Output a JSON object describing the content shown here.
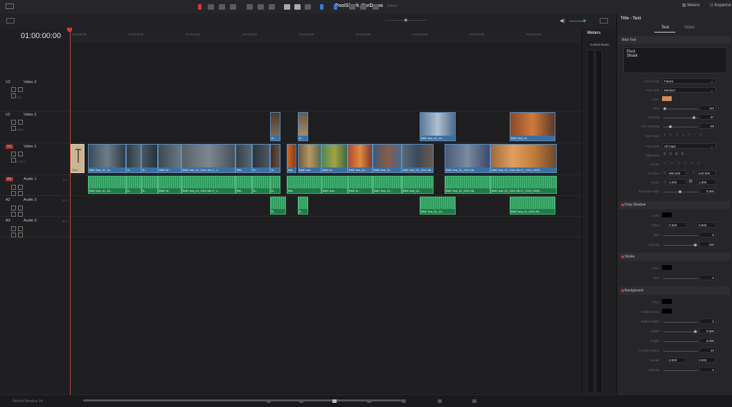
{
  "app": {
    "project_title": "PoolShark_ForDemo",
    "project_status": "Edited",
    "meters_button": "Meters",
    "inspector_button": "Inspector",
    "brand": "DaVinci Resolve 14"
  },
  "timeline": {
    "timecode": "01:00:00:00",
    "ruler_ticks": [
      "01:00:00:00",
      "01:00:10:00",
      "01:00:20:00",
      "01:00:30:00",
      "01:00:40:00",
      "01:00:50:00",
      "01:01:00:00",
      "01:01:10:00",
      "01:01:20:00"
    ],
    "tracks": [
      {
        "id": "V3",
        "name": "Video 3",
        "count": "0 Clip"
      },
      {
        "id": "V2",
        "name": "Video 2",
        "count": "6 Clips"
      },
      {
        "id": "V1",
        "name": "Video 1",
        "count": "18 Clips"
      },
      {
        "id": "A1",
        "name": "Audio 1",
        "vol": "2.0"
      },
      {
        "id": "A2",
        "name": "Audio 2",
        "vol": "2.0"
      },
      {
        "id": "A3",
        "name": "Audio 3",
        "vol": "2.0"
      }
    ],
    "v1_clip_labels": [
      "BMC test_01_20...",
      "B...",
      "B...",
      "BMC te...",
      "BMC test_01_2012-08-17_1...",
      "BM...",
      "B...",
      "B...",
      "BM...",
      "BMC test...",
      "BMC te...",
      "BMC test_01...",
      "BMC test_01...",
      "BMC test_01_2012-08...",
      "BMC test_01_2012-08-17_1754_C005..."
    ],
    "v2_clip_labels": [
      "B...",
      "BMC test_01_20...",
      "BMC test_01..."
    ],
    "text_clip_label": "Text...",
    "a1_clip_labels": [
      "BMC test_01_20...",
      "B...",
      "B...",
      "BMC te...",
      "BMC test_01_2012-08-17_1...",
      "BM...",
      "B...",
      "B...",
      "BM...",
      "BMC test...",
      "BMC te...",
      "BMC test_01...",
      "BMC test_01...",
      "BMC test_01_2012-08...",
      "BMC test_01_2012-08-17_1754_C005..."
    ],
    "a2_clip_labels": [
      "B...",
      "B...",
      "BMC test_01_20...",
      "BMC test_01_2012-08..."
    ]
  },
  "meters": {
    "title": "Meters",
    "control_room": "Control Room"
  },
  "inspector": {
    "title": "Title - Text",
    "tabs": [
      "Text",
      "Video"
    ],
    "rich_text_header": "Rich Text",
    "rich_text_value": [
      "Pool",
      "Shark"
    ],
    "props": {
      "font_family": {
        "label": "Font family",
        "value": "Futura"
      },
      "font_face": {
        "label": "Font face",
        "value": "Medium"
      },
      "color": {
        "label": "Color",
        "value": "#d68a5a"
      },
      "size": {
        "label": "Size",
        "value": "113"
      },
      "tracking": {
        "label": "Tracking",
        "value": "97"
      },
      "line_spacing": {
        "label": "Line Spacing",
        "value": "-58"
      },
      "kern_style": {
        "label": "Kern style"
      },
      "font_case": {
        "label": "Font case",
        "value": "All Caps"
      },
      "alignment": {
        "label": "Alignment"
      },
      "anchor": {
        "label": "Anchor"
      },
      "position": {
        "label": "Position",
        "x": "960.000",
        "y": "540.000"
      },
      "zoom": {
        "label": "Zoom",
        "x": "1.000",
        "y": "1.000"
      },
      "rotation": {
        "label": "Rotation Angle",
        "value": "0.000"
      }
    },
    "drop_shadow": {
      "header": "Drop Shadow",
      "color_label": "Color",
      "offset_label": "Offset",
      "offset_x": "0.000",
      "offset_y": "0.000",
      "blur_label": "Blur",
      "blur": "5",
      "opacity_label": "Opacity",
      "opacity": "100"
    },
    "stroke": {
      "header": "Stroke",
      "color_label": "Color",
      "size_label": "Size",
      "size": "0"
    },
    "background": {
      "header": "Background",
      "color_label": "Color",
      "outline_color_label": "Outline Color",
      "outline_width_label": "Outline Width",
      "outline_width": "0",
      "width_label": "Width",
      "width": "0.900",
      "height_label": "Height",
      "height": "0.000",
      "corner_radius_label": "Corner Radius",
      "corner_radius": "40",
      "center_label": "Center",
      "center_x": "0.000",
      "center_y": "0.000",
      "opacity_label": "Opacity",
      "opacity": "0"
    }
  }
}
